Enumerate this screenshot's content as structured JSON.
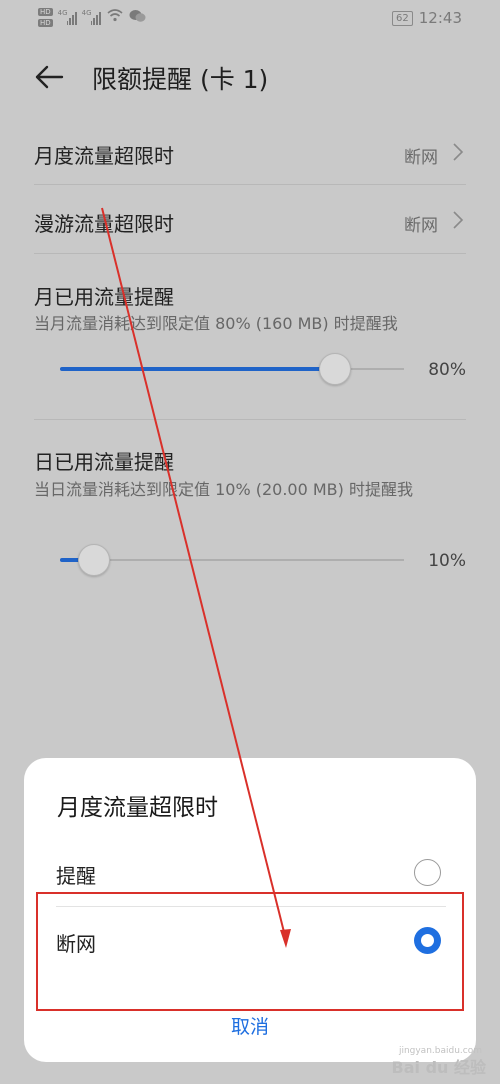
{
  "status_bar": {
    "hd1": "HD",
    "hd2": "HD",
    "sig1": "4G",
    "sig2": "4G",
    "battery": "62",
    "time": "12:43"
  },
  "header": {
    "title": "限额提醒 (卡 1)"
  },
  "rows": [
    {
      "label": "月度流量超限时",
      "value": "断网"
    },
    {
      "label": "漫游流量超限时",
      "value": "断网"
    }
  ],
  "monthly": {
    "title": "月已用流量提醒",
    "desc": "当月流量消耗达到限定值 80% (160 MB) 时提醒我",
    "level": 0.8,
    "percent": "80%"
  },
  "daily": {
    "title": "日已用流量提醒",
    "desc": "当日流量消耗达到限定值 10% (20.00 MB) 时提醒我",
    "level": 0.1,
    "percent": "10%"
  },
  "sheet": {
    "title": "月度流量超限时",
    "options": [
      {
        "label": "提醒",
        "selected": false
      },
      {
        "label": "断网",
        "selected": true
      }
    ],
    "cancel": "取消"
  },
  "watermark": {
    "text": "Bai du 经验",
    "url": "jingyan.baidu.com"
  },
  "colors": {
    "accent": "#1f6fe0",
    "annotation": "#d9302a"
  }
}
